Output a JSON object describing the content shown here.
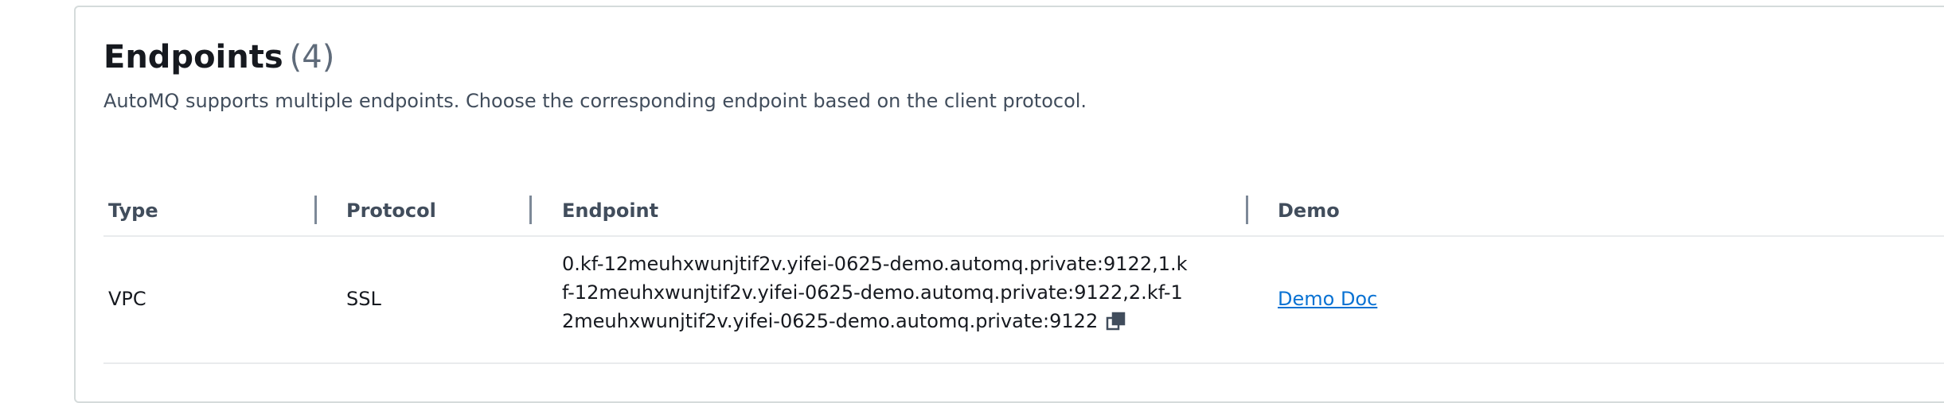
{
  "section": {
    "title": "Endpoints",
    "count": "(4)",
    "description": "AutoMQ supports multiple endpoints. Choose the corresponding endpoint based on the client protocol."
  },
  "table": {
    "columns": [
      "Type",
      "Protocol",
      "Endpoint",
      "Demo"
    ],
    "rows": [
      {
        "type": "VPC",
        "protocol": "SSL",
        "endpoint": "0.kf-12meuhxwunjtif2v.yifei-0625-demo.automq.private:9122,1.kf-12meuhxwunjtif2v.yifei-0625-demo.automq.private:9122,2.kf-12meuhxwunjtif2v.yifei-0625-demo.automq.private:9122",
        "demo_link": "Demo Doc",
        "copy_icon": "copy-icon"
      }
    ]
  },
  "colors": {
    "link": "#0972d3",
    "header_text": "#414d5c",
    "border": "#d5dbdb"
  }
}
